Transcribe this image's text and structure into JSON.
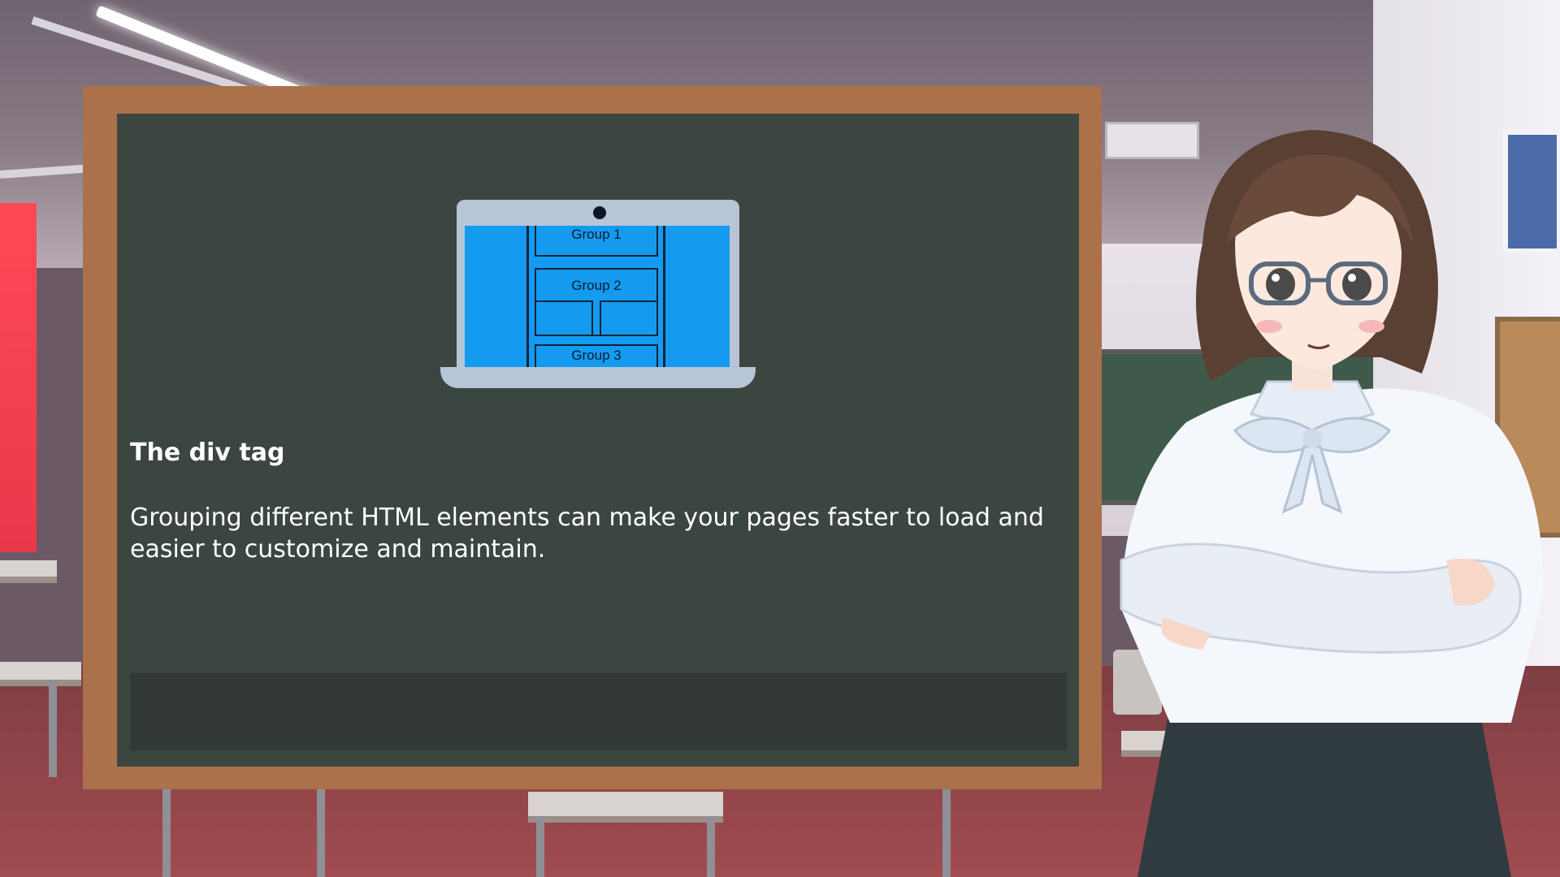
{
  "slide": {
    "title": "The div tag",
    "body": "Grouping different HTML elements can make your pages faster to load and easier to customize and maintain."
  },
  "illustration": {
    "groups": [
      "Group 1",
      "Group 2",
      "Group 3"
    ]
  },
  "dialogue": {
    "text": ""
  },
  "colors": {
    "board": "#3b4640",
    "board_frame": "#ab714b",
    "screen": "#149bf0",
    "laptop_body": "#b8c5d6",
    "dialogue_box": "#323935"
  }
}
